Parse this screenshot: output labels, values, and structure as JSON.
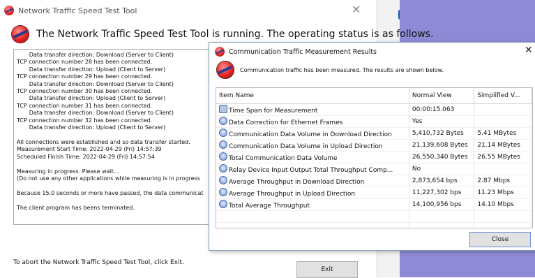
{
  "main_window": {
    "title": "Network Traffic Speed Test Tool",
    "header": "The Network Traffic Speed Test Tool is running. The operating status is as follows.",
    "log_lines": [
      "       Data transfer direction: Download (Server to Client)",
      "TCP connection number 28 has been connected.",
      "       Data transfer direction: Upload (Client to Server)",
      "TCP connection number 29 has been connected.",
      "       Data transfer direction: Download (Server to Client)",
      "TCP connection number 30 has been connected.",
      "       Data transfer direction: Upload (Client to Server)",
      "TCP connection number 31 has been connected.",
      "       Data transfer direction: Download (Server to Client)",
      "TCP connection number 32 has been connected.",
      "       Data transfer direction: Upload (Client to Server)",
      "",
      "All connections were established and so data transfer started.",
      "Measurement Start Time: 2022-04-29 (Fri) 14:57:39",
      "Scheduled Finish Time: 2022-04-29 (Fri) 14:57:54",
      "",
      "Measuring in progress. Please wait...",
      "(Do not use any other applications while measuring is in progress",
      "",
      "Because 15.0 seconds or more have passed, the data communicat",
      "",
      "The client program has beens terminated."
    ],
    "abort_text": "To abort the Network Traffic Speed Test Tool, click Exit.",
    "exit_label": "Exit",
    "close_symbol": "✕"
  },
  "background_fragment": "n",
  "dialog": {
    "title": "Communication Traffic Measurement Results",
    "close_symbol": "✕",
    "message": "Communication traffic has been measured. The results are shown below.",
    "columns": [
      "Item Name",
      "Normal View",
      "Simplified V..."
    ],
    "rows": [
      {
        "icon": "clock-icon",
        "name": "Time Span for Measurement",
        "normal": "00:00:15.063",
        "simple": ""
      },
      {
        "icon": "measure-icon",
        "name": "Data Correction for Ethernet Frames",
        "normal": "Yes",
        "simple": ""
      },
      {
        "icon": "measure-icon",
        "name": "Communication Data Volume in Download Direction",
        "normal": "5,410,732 Bytes",
        "simple": "5.41 MBytes"
      },
      {
        "icon": "measure-icon",
        "name": "Communication Data Volume in Upload Direction",
        "normal": "21,139,608 Bytes",
        "simple": "21.14 MBytes"
      },
      {
        "icon": "measure-icon",
        "name": "Total Communication Data Volume",
        "normal": "26,550,340 Bytes",
        "simple": "26.55 MBytes"
      },
      {
        "icon": "measure-icon",
        "name": "Relay Device Input Output Total Throughput Comp...",
        "normal": "No",
        "simple": ""
      },
      {
        "icon": "measure-icon",
        "name": "Average Throughput in Download Direction",
        "normal": "2,873,654 bps",
        "simple": "2.87 Mbps"
      },
      {
        "icon": "measure-icon",
        "name": "Average Throughput in Upload Direction",
        "normal": "11,227,302 bps",
        "simple": "11.23 Mbps"
      },
      {
        "icon": "measure-icon",
        "name": "Total Average Throughput",
        "normal": "14,100,956 bps",
        "simple": "14.10 Mbps"
      }
    ],
    "close_label": "Close"
  }
}
